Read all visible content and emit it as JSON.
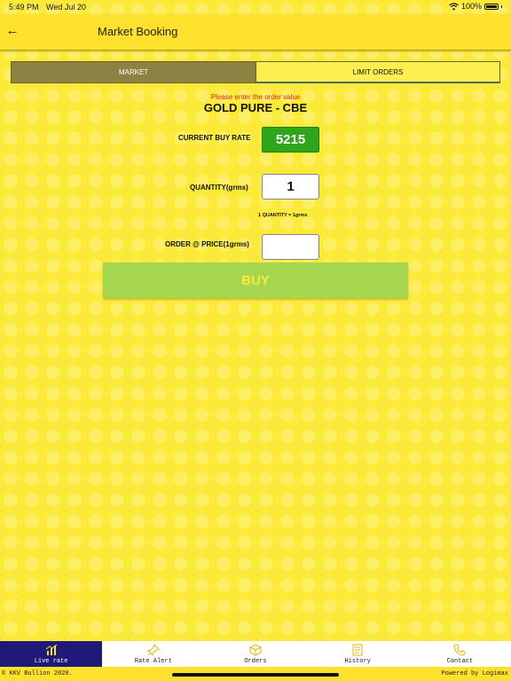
{
  "status_bar": {
    "time": "5:49 PM",
    "date": "Wed Jul 20",
    "battery": "100%"
  },
  "header": {
    "back_icon": "arrow-left-icon",
    "title": "Market Booking"
  },
  "tabs": [
    {
      "label": "MARKET",
      "active": true
    },
    {
      "label": "LIMIT ORDERS",
      "active": false
    }
  ],
  "form": {
    "prompt": "Please enter the order value",
    "product": "GOLD PURE - CBE",
    "rate_label": "CURRENT BUY RATE",
    "rate_value": "5215",
    "quantity_label": "QUANTITY(grms)",
    "quantity_value": "1",
    "quantity_note": "1 QUANTITY = 1grms",
    "price_label": "ORDER @ PRICE(1grms)",
    "price_value": "",
    "buy_label": "BUY"
  },
  "nav": [
    {
      "label": "Live rate",
      "icon": "bar-chart-icon",
      "active": true
    },
    {
      "label": "Rate Alert",
      "icon": "pin-icon",
      "active": false
    },
    {
      "label": "Orders",
      "icon": "box-icon",
      "active": false
    },
    {
      "label": "History",
      "icon": "document-icon",
      "active": false
    },
    {
      "label": "Contact",
      "icon": "phone-icon",
      "active": false
    }
  ],
  "footer": {
    "copyright": "© KKV Bullion 2020.",
    "powered": "Powered by Logimax"
  },
  "colors": {
    "background": "#fcea3a",
    "rate_badge": "#2ea51a",
    "buy_button": "#a6d650",
    "nav_active": "#1f1a7a",
    "prompt_text": "#e1281e"
  }
}
